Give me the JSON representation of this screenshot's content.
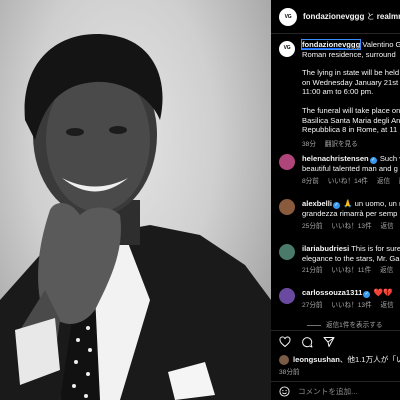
{
  "post": {
    "username": "fondazionevggg",
    "collab_sep": "と",
    "collab_user": "realmrv",
    "avatar_text": "VG"
  },
  "caption": {
    "username": "fondazionevggg",
    "line1_rest": "Valentino G",
    "line2": "Roman residence, surround",
    "p2_l1": "The lying in state will be held",
    "p2_l2": "on Wednesday January 21st",
    "p2_l3": "11:00 am to 6:00 pm.",
    "p3_l1": "The funeral will take place on",
    "p3_l2": "Basilica Santa Maria degli An",
    "p3_l3": "Repubblica 8 in Rome, at 11",
    "time": "38分",
    "translate": "翻訳を見る"
  },
  "comments": [
    {
      "user": "helenachristensen",
      "line1": "Such v",
      "line2": "beautiful talented man and g",
      "time": "8分前",
      "likes": "いいね！14件",
      "reply": "返信",
      "translate": "翻訳",
      "avatar_color": "#b0457a"
    },
    {
      "user": "alexbelli",
      "line1": "🙏 un uomo, un ma",
      "line2": "grandezza rimarrà per semp",
      "time": "25分前",
      "likes": "いいね！13件",
      "reply": "返信",
      "translate": "翻訳",
      "avatar_color": "#8a5a3c"
    },
    {
      "user": "ilariabudriesi",
      "line1": "This is for sure",
      "line2": "elegance to the stars, Mr. Ga",
      "time": "21分前",
      "likes": "いいね！11件",
      "reply": "返信",
      "translate": "翻訳",
      "avatar_color": "#4a7a6a"
    },
    {
      "user": "carlossouza1311",
      "line1": "❤️💔",
      "line2": "",
      "time": "27分前",
      "likes": "いいね！13件",
      "reply": "返信",
      "translate": "翻訳",
      "avatar_color": "#6a4aa0"
    }
  ],
  "replies_label": "返信1件を表示する",
  "likes": {
    "user": "leongsushan",
    "rest": "、他1.1万人が「いい"
  },
  "post_time": "38分前",
  "add_comment_placeholder": "コメントを追加...",
  "colors": {
    "verified": "#3897f0",
    "background": "#000000",
    "secondary_text": "#a8a8a8"
  }
}
